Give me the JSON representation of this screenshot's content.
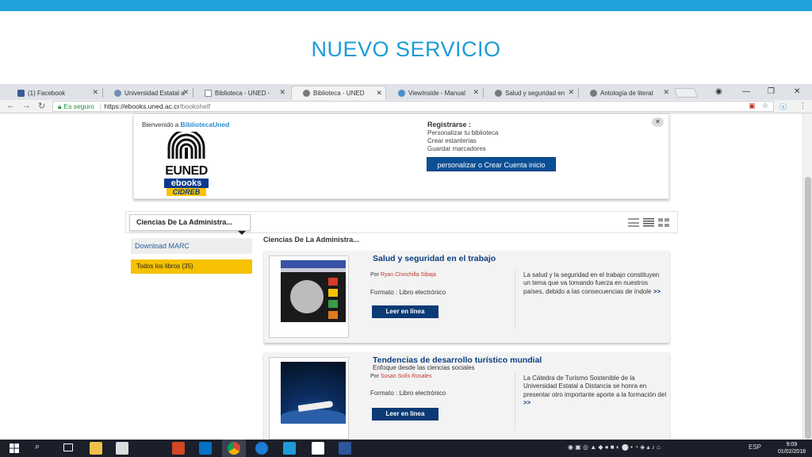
{
  "slide": {
    "title": "NUEVO SERVICIO"
  },
  "browser": {
    "tabs": [
      {
        "label": "(1) Facebook",
        "active": false
      },
      {
        "label": "Universidad Estatal a",
        "active": false
      },
      {
        "label": "Biblioteca - UNED - ",
        "active": false
      },
      {
        "label": "Biblioteca - UNED",
        "active": true
      },
      {
        "label": "ViewInside - Manual",
        "active": false
      },
      {
        "label": "Salud y seguridad en",
        "active": false
      },
      {
        "label": "Antología de literat",
        "active": false
      }
    ],
    "secure_label": "Es seguro",
    "url_host": "https://ebooks.uned.ac.cr",
    "url_path": "/bookshelf"
  },
  "welcome": {
    "prefix": "Bienvenido a ",
    "brand": "BibliotecaUned",
    "logo": {
      "line1": "EUNED",
      "line2": "ebooks",
      "line3": "CIDREB"
    },
    "register_title": "Registrarse :",
    "register_items": [
      "Personalizar tu biblioteca",
      "Crear estanterías",
      "Guardar marcadores"
    ],
    "register_button": "personalizar o Crear Cuenta inicio",
    "close": "✕"
  },
  "category": {
    "selected": "Ciencias De La Administra...",
    "section_title": "Ciencias De La Administra..."
  },
  "sidebar": {
    "download": "Download MARC",
    "all_books": "Todos los libros (35)"
  },
  "books": [
    {
      "title": "Salud y seguridad en el trabajo",
      "subtitle": "",
      "by_prefix": "Por ",
      "author": "Ryan Chinchilla Sibaja",
      "format": "Formato : Libro electrónico",
      "button": "Leer en línea",
      "description": "La salud y la seguridad en el trabajo constituyen un tema que va tomando fuerza en nuestros países, debido a las consecuencias de índole",
      "more": ">>"
    },
    {
      "title": "Tendencias de desarrollo turístico mundial",
      "subtitle": "Enfoque desde las ciencias sociales",
      "by_prefix": "Por ",
      "author": "Susan Solís Rosales",
      "format": "Formato : Libro electrónico",
      "button": "Leer en línea",
      "description": "La Cátedra de Turismo Sostenible de la Universidad Estatal a Distancia se honra en presentar otro importante aporte a la formación del",
      "more": ">>"
    }
  ],
  "taskbar": {
    "lang": "ESP",
    "time": "9:09",
    "date": "01/02/2018"
  }
}
